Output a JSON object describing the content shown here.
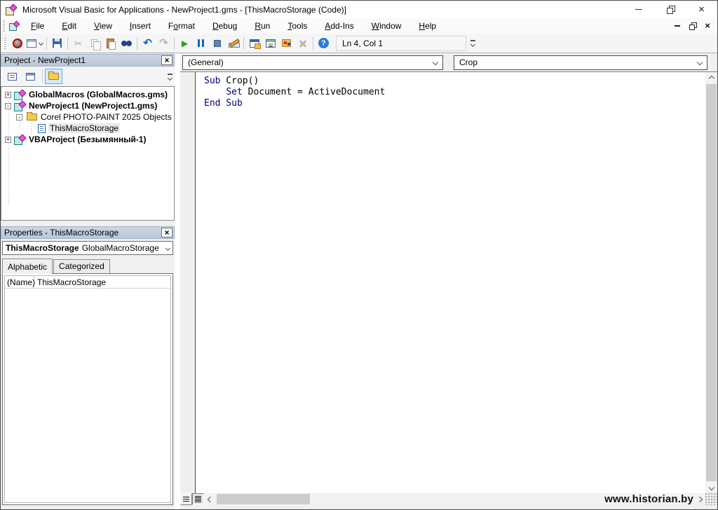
{
  "window": {
    "title": "Microsoft Visual Basic for Applications - NewProject1.gms - [ThisMacroStorage (Code)]"
  },
  "menu": {
    "items": [
      {
        "pre": "",
        "key": "F",
        "post": "ile"
      },
      {
        "pre": "",
        "key": "E",
        "post": "dit"
      },
      {
        "pre": "",
        "key": "V",
        "post": "iew"
      },
      {
        "pre": "",
        "key": "I",
        "post": "nsert"
      },
      {
        "pre": "F",
        "key": "o",
        "post": "rmat"
      },
      {
        "pre": "",
        "key": "D",
        "post": "ebug"
      },
      {
        "pre": "",
        "key": "R",
        "post": "un"
      },
      {
        "pre": "",
        "key": "T",
        "post": "ools"
      },
      {
        "pre": "",
        "key": "A",
        "post": "dd-Ins"
      },
      {
        "pre": "",
        "key": "W",
        "post": "indow"
      },
      {
        "pre": "",
        "key": "H",
        "post": "elp"
      }
    ]
  },
  "toolbar": {
    "position_status": "Ln 4, Col 1",
    "buttons": [
      "view-corel-photo-paint",
      "insert-userform",
      "save",
      "cut",
      "copy",
      "paste",
      "find",
      "undo",
      "redo",
      "run",
      "break",
      "reset",
      "design-mode",
      "project-explorer",
      "properties-window",
      "object-browser",
      "toolbox",
      "help"
    ]
  },
  "project_panel": {
    "title": "Project - NewProject1",
    "tree": [
      {
        "expander": "+",
        "label": "GlobalMacros (GlobalMacros.gms)"
      },
      {
        "expander": "-",
        "label": "NewProject1 (NewProject1.gms)"
      },
      {
        "expander": "-",
        "label": "Corel PHOTO-PAINT 2025 Objects"
      },
      {
        "expander": "",
        "label": "ThisMacroStorage"
      },
      {
        "expander": "+",
        "label": "VBAProject (Безымянный-1)"
      }
    ]
  },
  "properties_panel": {
    "title": "Properties - ThisMacroStorage",
    "selected_object": "ThisMacroStorage",
    "selected_object_type": "GlobalMacroStorage",
    "tabs": [
      "Alphabetic",
      "Categorized"
    ],
    "rows": [
      {
        "name": "(Name)",
        "value": "ThisMacroStorage"
      }
    ]
  },
  "code_pane": {
    "object_dropdown": "(General)",
    "procedure_dropdown": "Crop",
    "lines": [
      {
        "segments": [
          {
            "text": "Sub",
            "type": "keyword"
          },
          {
            "text": " Crop()",
            "type": "plain"
          }
        ]
      },
      {
        "segments": [
          {
            "text": "    ",
            "type": "plain"
          },
          {
            "text": "Set",
            "type": "keyword"
          },
          {
            "text": " Document = ActiveDocument",
            "type": "plain"
          }
        ]
      },
      {
        "segments": [
          {
            "text": "End Sub",
            "type": "keyword"
          }
        ]
      }
    ]
  },
  "watermark": {
    "text": "www.historian.by"
  },
  "colors": {
    "keyword": "#000080",
    "panel_header": "#C1CEDE",
    "run_green": "#21A121",
    "toolbar_bg": "#F5F5F5",
    "scroll_thumb": "#CDCDCD"
  },
  "icons": {
    "minimize-icon": "–",
    "restore-icon": "❐",
    "close-icon": "×",
    "dropdown-icon": "▾",
    "expander-collapsed": "+",
    "expander-expanded": "-"
  }
}
